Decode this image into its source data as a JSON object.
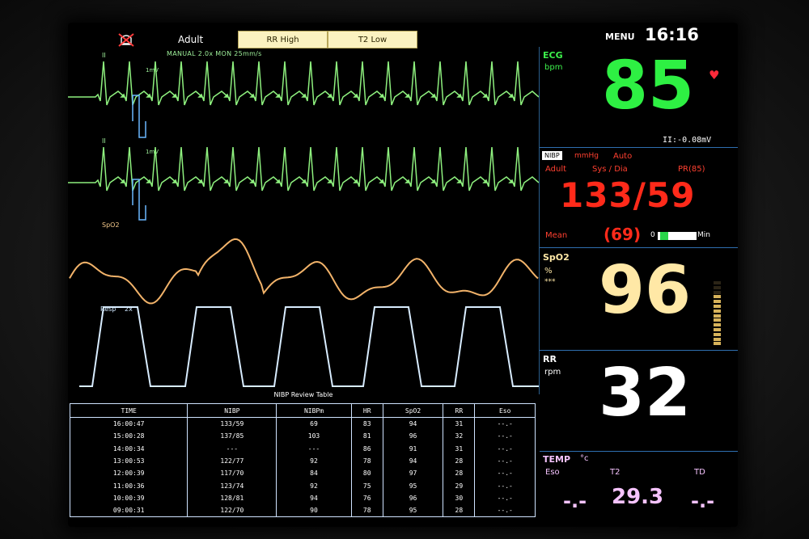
{
  "top_bar": {
    "patient_type": "Adult",
    "alarms": [
      "RR High",
      "T2 Low"
    ],
    "menu_label": "MENU",
    "time": "16:16"
  },
  "waveforms": {
    "ecg_info": "MANUAL  2.0x  MON  25mm/s",
    "lead_1": "II",
    "lead_2": "II",
    "cal_1": "1mV",
    "cal_2": "1mV",
    "spo2_label": "SpO2",
    "resp_label": "Resp",
    "resp_gain": "2x"
  },
  "ecg": {
    "label": "ECG",
    "unit": "bpm",
    "value": "85",
    "st_value": "II:-0.08mV",
    "color": "#2ef043"
  },
  "nibp": {
    "label": "NIBP",
    "unit": "mmHg",
    "mode": "Auto",
    "patient_type": "Adult",
    "sub_label": "Sys / Dia",
    "pr": "PR(85)",
    "value": "133/59",
    "mean_label": "Mean",
    "mean_value": "(69)",
    "bar_zero": "0",
    "bar_max": "Min",
    "color": "#ff2a1a"
  },
  "spo2": {
    "label": "SpO2",
    "unit": "%",
    "marker": "***",
    "value": "96",
    "level": 0.75,
    "color": "#ffe8a6"
  },
  "rr": {
    "label": "RR",
    "unit": "rpm",
    "value": "32",
    "color": "#ffffff"
  },
  "temp": {
    "label": "TEMP",
    "unit": "°c",
    "channels": [
      {
        "name": "Eso",
        "value": "-.-"
      },
      {
        "name": "T2",
        "value": "29.3"
      },
      {
        "name": "TD",
        "value": "-.-"
      }
    ],
    "color": "#f6c3ff"
  },
  "nibp_table": {
    "title": "NIBP Review Table",
    "headers": [
      "TIME",
      "NIBP",
      "NIBPm",
      "HR",
      "SpO2",
      "RR",
      "Eso"
    ],
    "rows": [
      [
        "16:00:47",
        "133/59",
        "69",
        "83",
        "94",
        "31",
        "--.-"
      ],
      [
        "15:00:28",
        "137/85",
        "103",
        "81",
        "96",
        "32",
        "--.-"
      ],
      [
        "14:00:34",
        "---",
        "---",
        "86",
        "91",
        "31",
        "--.-"
      ],
      [
        "13:00:53",
        "122/77",
        "92",
        "78",
        "94",
        "28",
        "--.-"
      ],
      [
        "12:00:39",
        "117/70",
        "84",
        "80",
        "97",
        "28",
        "--.-"
      ],
      [
        "11:00:36",
        "123/74",
        "92",
        "75",
        "95",
        "29",
        "--.-"
      ],
      [
        "10:00:39",
        "128/81",
        "94",
        "76",
        "96",
        "30",
        "--.-"
      ],
      [
        "09:00:31",
        "122/70",
        "90",
        "78",
        "95",
        "28",
        "--.-"
      ]
    ]
  }
}
